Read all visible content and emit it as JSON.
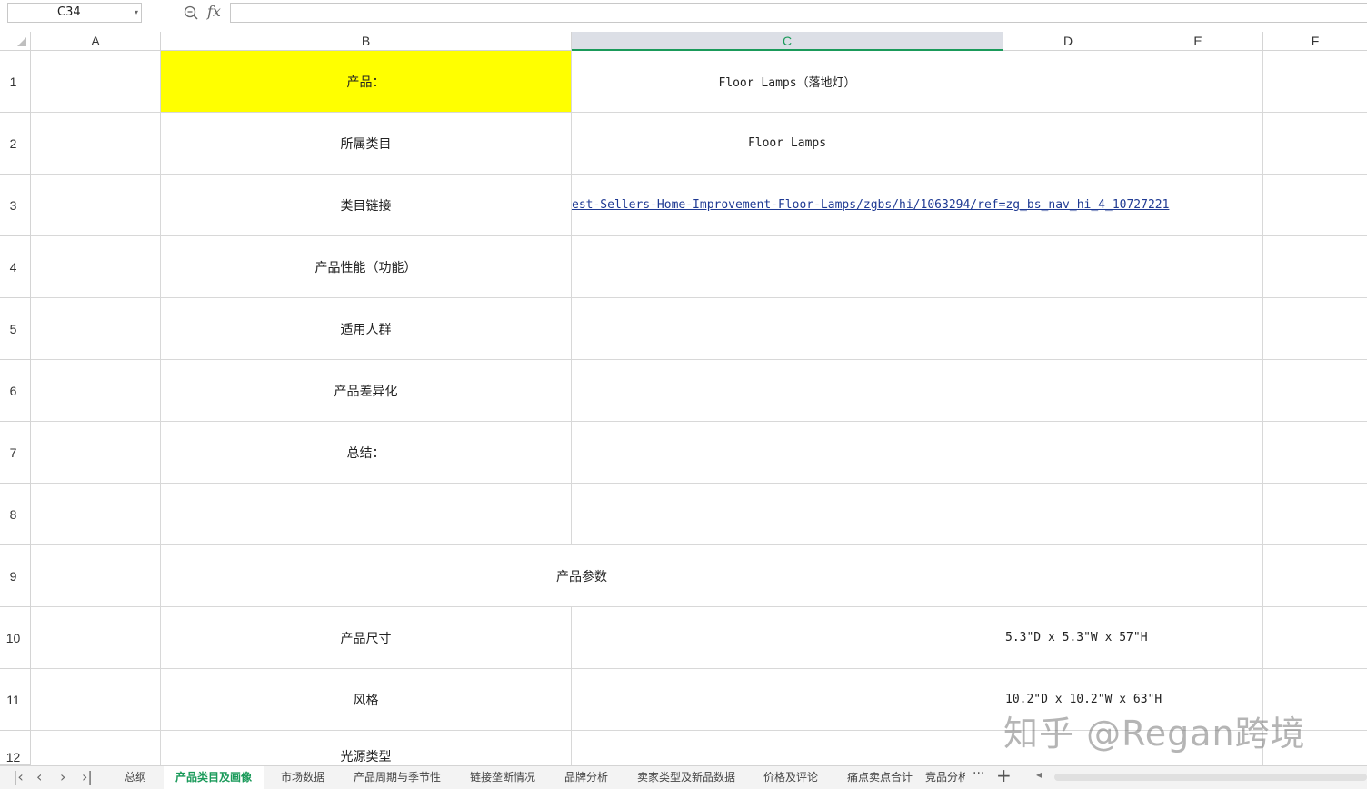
{
  "formula_bar": {
    "name_box": "C34",
    "fx_label": "fx",
    "formula": ""
  },
  "columns": [
    "A",
    "B",
    "C",
    "D",
    "E",
    "F"
  ],
  "selected_column": "C",
  "rows": [
    "1",
    "2",
    "3",
    "4",
    "5",
    "6",
    "7",
    "8",
    "9",
    "10",
    "11",
    "12"
  ],
  "cells": {
    "B1": "产品：",
    "C1": "Floor Lamps（落地灯）",
    "B2": "所属类目",
    "C2": "Floor Lamps",
    "B3": "类目链接",
    "C3": "est-Sellers-Home-Improvement-Floor-Lamps/zgbs/hi/1063294/ref=zg_bs_nav_hi_4_10727221",
    "B4": "产品性能（功能）",
    "B5": "适用人群",
    "B6": "产品差异化",
    "B7": "总结：",
    "B9": "产品参数",
    "B10": "产品尺寸",
    "D10": "5.3\"D x 5.3\"W x 57\"H",
    "B11": "风格",
    "D11": "10.2\"D x 10.2\"W x 63\"H",
    "B12": "光源类型"
  },
  "colors": {
    "highlight": "#ffff00",
    "accent": "#1a9a5a",
    "link": "#1f3a93"
  },
  "watermark": "知乎 @Regan跨境",
  "sheet_tabs": [
    "总纲",
    "产品类目及画像",
    "市场数据",
    "产品周期与季节性",
    "链接垄断情况",
    "品牌分析",
    "卖家类型及新品数据",
    "价格及评论",
    "痛点卖点合计",
    "竞品分析"
  ],
  "active_tab": "产品类目及画像",
  "tab_more": "···",
  "tab_add": "+"
}
